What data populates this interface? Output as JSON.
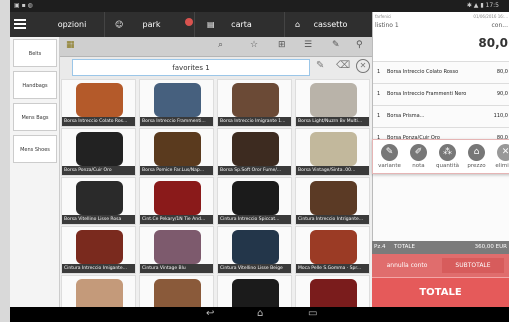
{
  "topbar": {
    "tabs": [
      {
        "label": "opzioni"
      },
      {
        "label": "park",
        "badge_color": "#d9534f"
      },
      {
        "label": "carta"
      },
      {
        "label": "cassetto"
      }
    ]
  },
  "sidebar": {
    "items": [
      "Belts",
      "Handbags",
      "Mens Bags",
      "Mens Shoes"
    ]
  },
  "favorites": {
    "label": "favorites 1"
  },
  "grid": {
    "items": [
      {
        "caption": "Borsa Intreccio Colato Ros...",
        "color": "#b45a2a"
      },
      {
        "caption": "Borsa Intreccio Frammenti...",
        "color": "#46607e"
      },
      {
        "caption": "Borsa Intreccio Imigrante 1...",
        "color": "#6b4a36"
      },
      {
        "caption": "Borsa Light/Nuzrn Bv Multi...",
        "color": "#b9b3a9"
      },
      {
        "caption": "Borsa Ponza/Cuir Oro",
        "color": "#222222"
      },
      {
        "caption": "Borsa Pomice Far.Lus/Nap...",
        "color": "#5a3a1e"
      },
      {
        "caption": "Borsa Sp.Soft Oror Fume/...",
        "color": "#3d2b20"
      },
      {
        "caption": "Borsa Vintage/Sinta..00...",
        "color": "#c2b89c"
      },
      {
        "caption": "Borsa Vitellino Lisse Rosa",
        "color": "#2a2a2a"
      },
      {
        "caption": "Cint.Ce Pekary/1N Tie And...",
        "color": "#8a1a1a"
      },
      {
        "caption": "Cintura Intreccio Spiccat...",
        "color": "#1b1b1b"
      },
      {
        "caption": "Cintura Intreccio Intrigante...",
        "color": "#5b3a25"
      },
      {
        "caption": "Cintura Intreccio Imigante...",
        "color": "#7a2a1e"
      },
      {
        "caption": "Cintura Vintage Blu",
        "color": "#7d5a6d"
      },
      {
        "caption": "Cintura Vitellino Lisse Beige",
        "color": "#23364a"
      },
      {
        "caption": "Moca Pelle S.Gomma · Spr...",
        "color": "#9b3b25"
      },
      {
        "caption": "",
        "color": "#c49a7a"
      },
      {
        "caption": "",
        "color": "#8a5a3a"
      },
      {
        "caption": "",
        "color": "#1b1b1b"
      },
      {
        "caption": "",
        "color": "#7a1c1c"
      }
    ]
  },
  "receipt": {
    "header_small_left": "farfenici",
    "header_small_right": "01/06/2016 16:...",
    "listino": "listino 1",
    "con_label": "con...",
    "amount": "80,0",
    "lines": [
      {
        "qty": "1",
        "desc": "Borsa Intreccio Colato Rosso",
        "price": "80,0"
      },
      {
        "qty": "1",
        "desc": "Borsa Intreccio Frammenti Nero",
        "price": "90,0"
      },
      {
        "qty": "1",
        "desc": "Borsa Prisma...",
        "price": "110,0"
      },
      {
        "qty": "1",
        "desc": "Borsa Ponza/Cuir Oro",
        "price": "80,0"
      }
    ],
    "pz_label": "Pz.4",
    "total_label": "TOTALE",
    "total_value": "360,00 EUR",
    "annulla_label": "annulla conto",
    "subtotale_label": "SUBTOTALE",
    "totale_button": "TOTALE"
  },
  "popup": {
    "buttons": [
      "variante",
      "nota",
      "quantità",
      "prezzo",
      "elimina"
    ]
  }
}
